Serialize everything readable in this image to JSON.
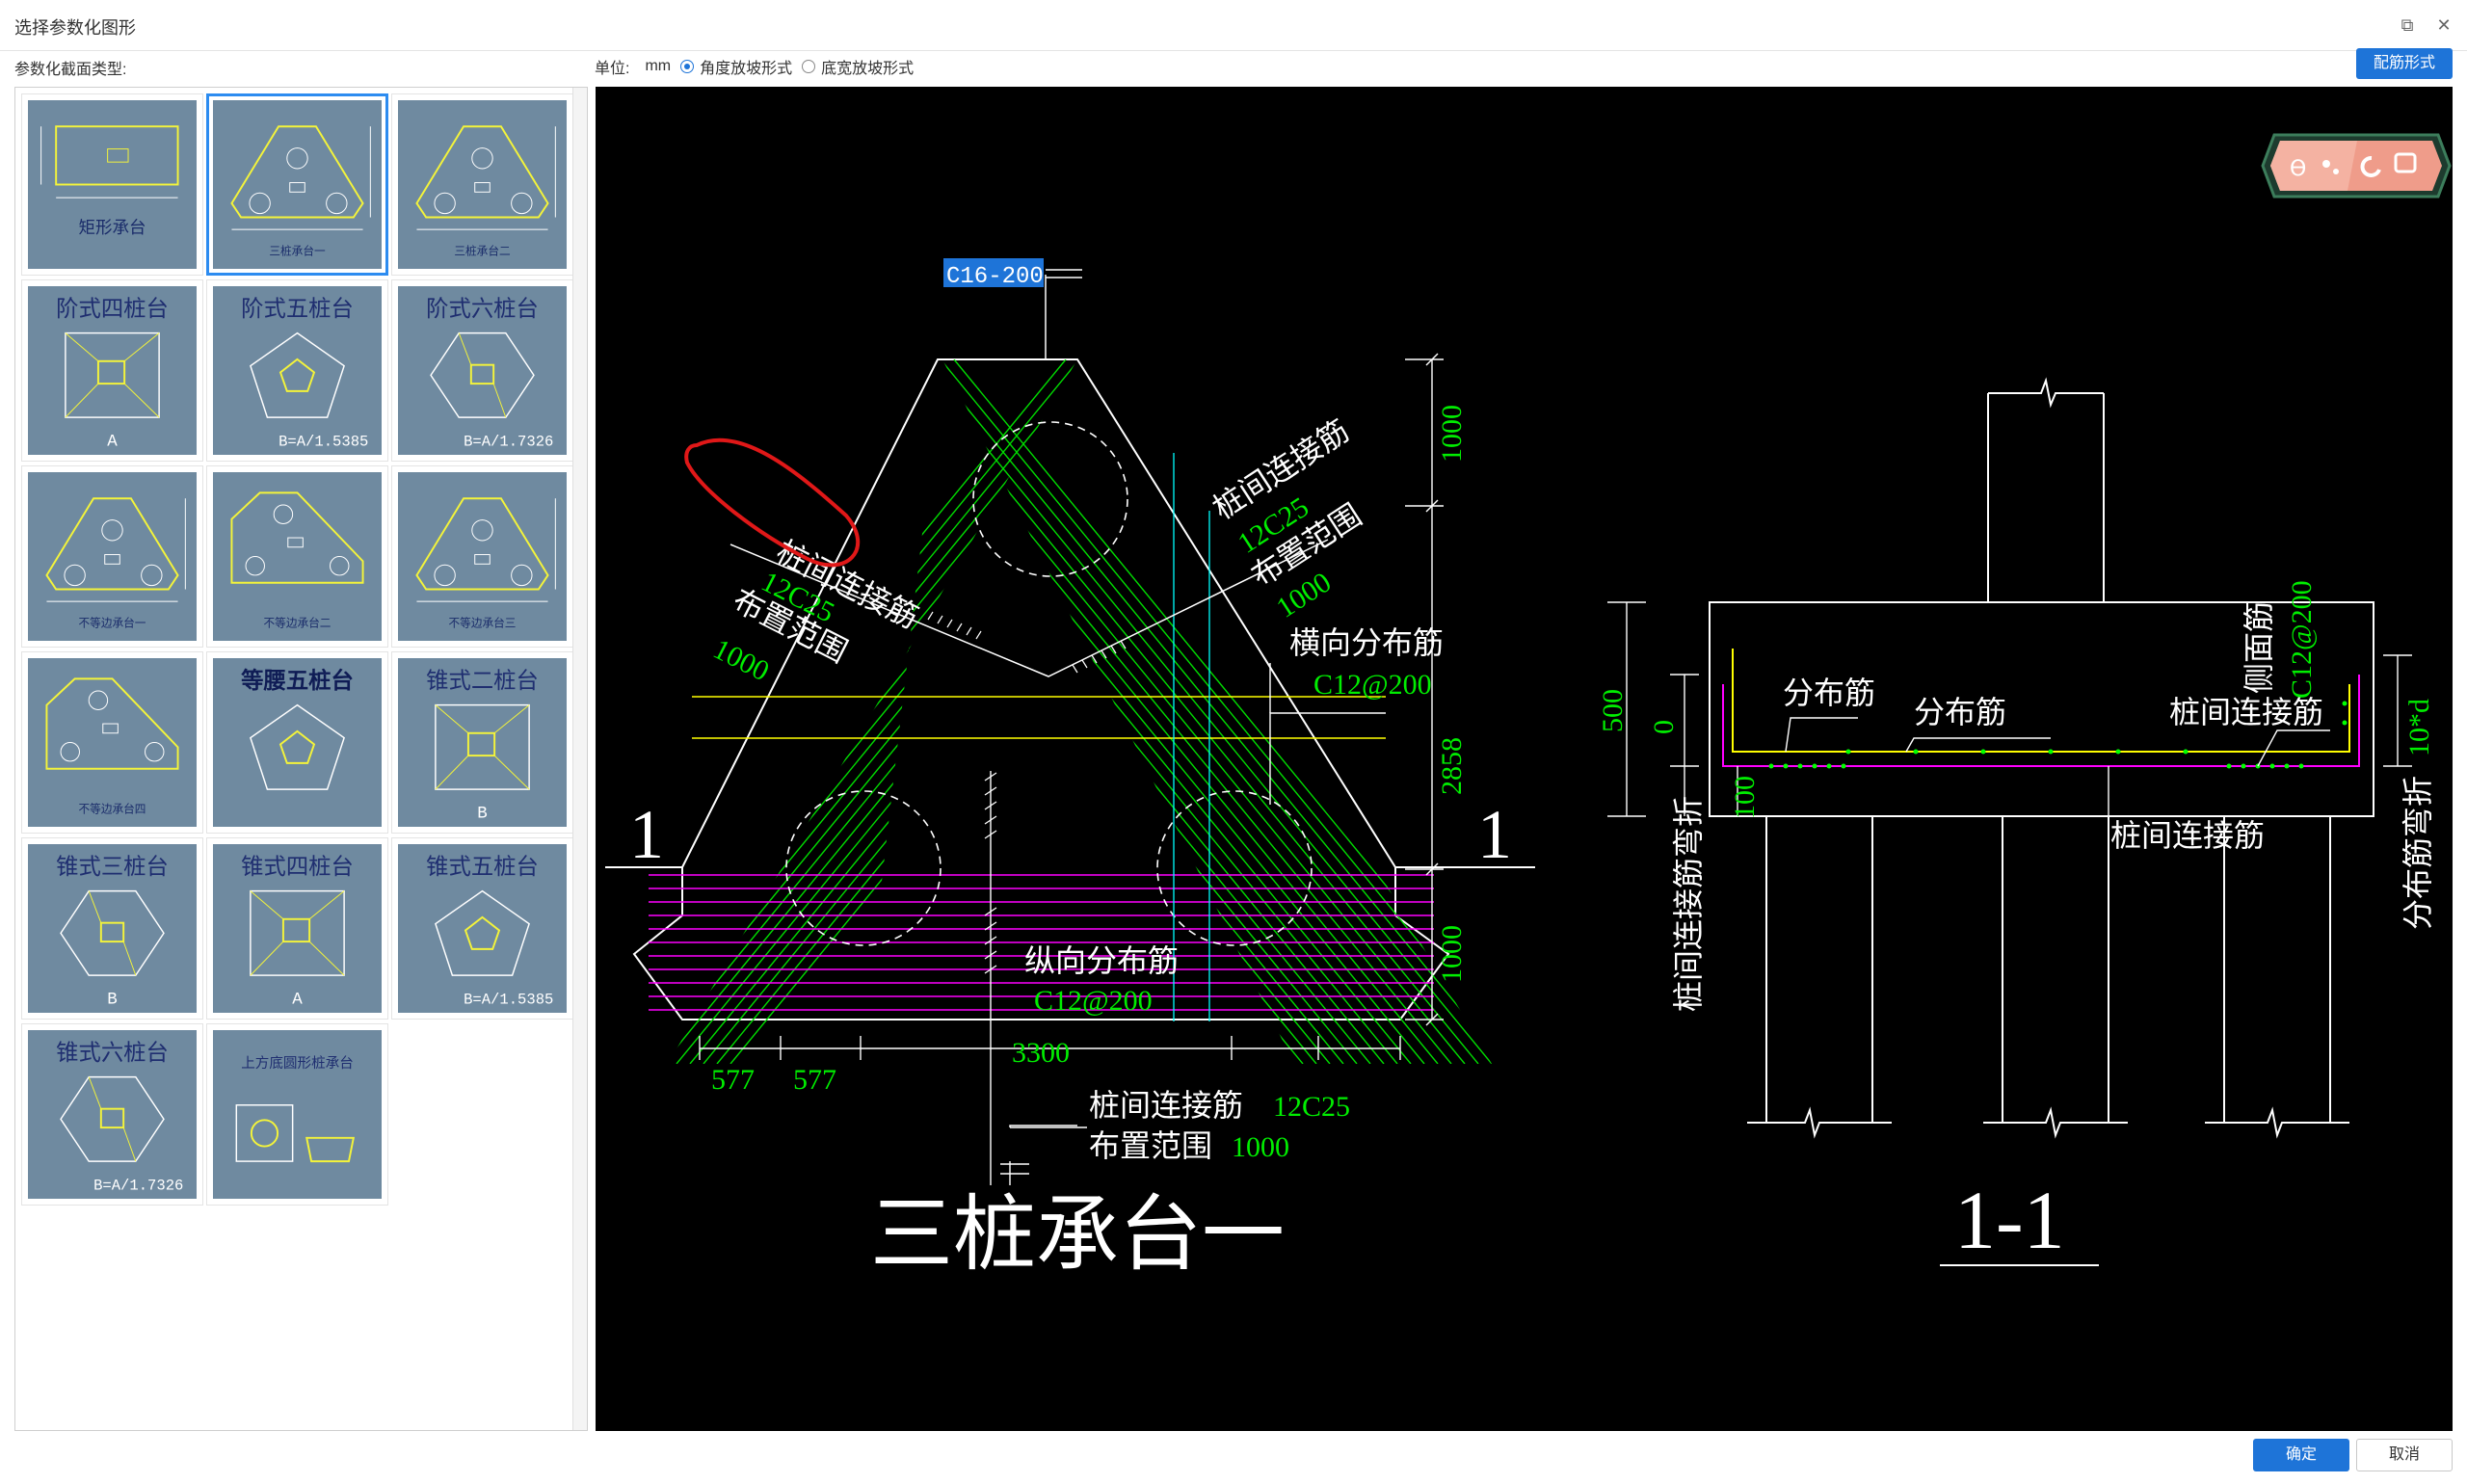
{
  "window": {
    "title": "选择参数化图形",
    "restore_glyph": "⧉",
    "close_glyph": "✕"
  },
  "left": {
    "label": "参数化截面类型:",
    "items": [
      {
        "name": "矩形承台",
        "thumb": "rect"
      },
      {
        "name": "三桩承台一",
        "thumb": "tri1",
        "selected": true
      },
      {
        "name": "三桩承台二",
        "thumb": "tri2"
      },
      {
        "name": "阶式四桩台",
        "sub": "A",
        "thumb": "step4"
      },
      {
        "name": "阶式五桩台",
        "sub": "B=A/1.5385",
        "thumb": "step5"
      },
      {
        "name": "阶式六桩台",
        "sub": "B=A/1.7326",
        "thumb": "step6"
      },
      {
        "name": "不等边承台一",
        "thumb": "uneq1"
      },
      {
        "name": "不等边承台二",
        "thumb": "uneq2"
      },
      {
        "name": "不等边承台三",
        "thumb": "uneq3"
      },
      {
        "name": "不等边承台四",
        "thumb": "uneq4"
      },
      {
        "name": "等腰五桩台",
        "thumb": "iso5"
      },
      {
        "name": "锥式二桩台",
        "sub": "B",
        "thumb": "cone2"
      },
      {
        "name": "锥式三桩台",
        "sub": "B",
        "thumb": "cone3"
      },
      {
        "name": "锥式四桩台",
        "sub": "A",
        "thumb": "cone4"
      },
      {
        "name": "锥式五桩台",
        "sub": "B=A/1.5385",
        "thumb": "cone5"
      },
      {
        "name": "锥式六桩台",
        "sub": "B=A/1.7326",
        "thumb": "cone6"
      },
      {
        "name": "上方底圆形桩承台",
        "thumb": "round"
      }
    ]
  },
  "top": {
    "unit_label": "单位:",
    "unit_value": "mm",
    "radio1": "角度放坡形式",
    "radio2": "底宽放坡形式",
    "rebar_button": "配筋形式"
  },
  "drawing": {
    "top_rebar": "C16-200",
    "left_conn": "桩间连接筋",
    "left_conn_spec": "12C25",
    "left_range": "布置范围",
    "left_range_val": "1000",
    "right_conn": "桩间连接筋",
    "right_conn_spec": "12C25",
    "right_range": "布置范围",
    "right_range_val": "1000",
    "transverse": "横向分布筋",
    "transverse_spec": "C12@200",
    "longitudinal": "纵向分布筋",
    "longitudinal_spec": "C12@200",
    "dim_top": "1000",
    "dim_mid": "2858",
    "dim_bot": "1000",
    "dim_577a": "577",
    "dim_577b": "577",
    "dim_3300": "3300",
    "bottom_conn": "桩间连接筋",
    "bottom_conn_spec": "12C25",
    "bottom_range": "布置范围",
    "bottom_range_val": "1000",
    "section_mark": "1",
    "plan_title": "三桩承台一",
    "sec_title": "1-1",
    "sec_dist1": "分布筋",
    "sec_dist2": "分布筋",
    "sec_conn1": "桩间连接筋",
    "sec_conn2": "桩间连接筋",
    "side_bar": "侧面筋",
    "side_bar_spec": "C12@200",
    "dim_500": "500",
    "dim_0": "0",
    "dim_100": "100",
    "left_vert": "桩间连接筋弯折",
    "right_vert": "分布筋弯折",
    "right_vert_dim": "10*d"
  },
  "footer": {
    "ok": "确定",
    "cancel": "取消"
  },
  "colors": {
    "accent": "#1e74d8",
    "thumb_bg": "#6f8aa0",
    "cad_green": "#00ff00",
    "cad_magenta": "#ff00ff",
    "cad_yellow": "#ffff00",
    "cad_cyan": "#00ffff",
    "markup_red": "#e01818"
  }
}
